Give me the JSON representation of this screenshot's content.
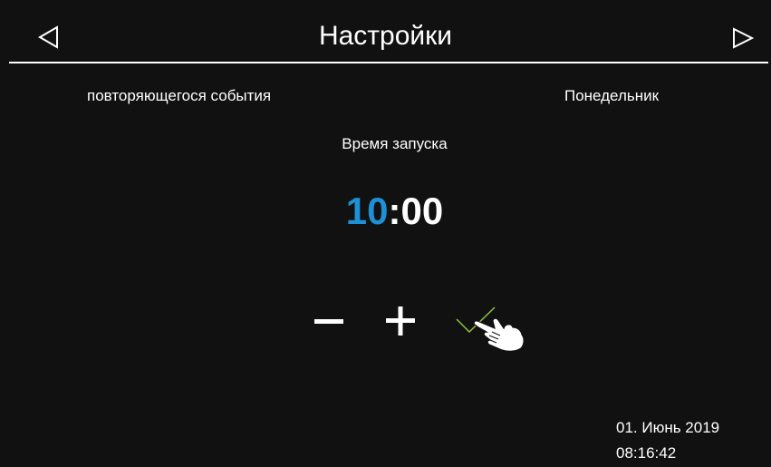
{
  "header": {
    "title": "Настройки",
    "prev_icon": "triangle-left-icon",
    "next_icon": "triangle-right-icon"
  },
  "event": {
    "label": "повторяющегося события",
    "value": "Понедельник"
  },
  "start_time": {
    "label": "Время запуска",
    "hours": "10",
    "separator": ":",
    "minutes": "00",
    "selected_part": "hours"
  },
  "controls": {
    "minus_icon": "minus-icon",
    "plus_icon": "plus-icon",
    "confirm_icon": "checkmark-icon",
    "pointer_icon": "hand-pointer-icon"
  },
  "status": {
    "date": "01. Июнь 2019",
    "time": "08:16:42"
  },
  "colors": {
    "background": "#111111",
    "text": "#ffffff",
    "accent_blue": "#1e90d6",
    "confirm_green": "#8dc63f"
  }
}
